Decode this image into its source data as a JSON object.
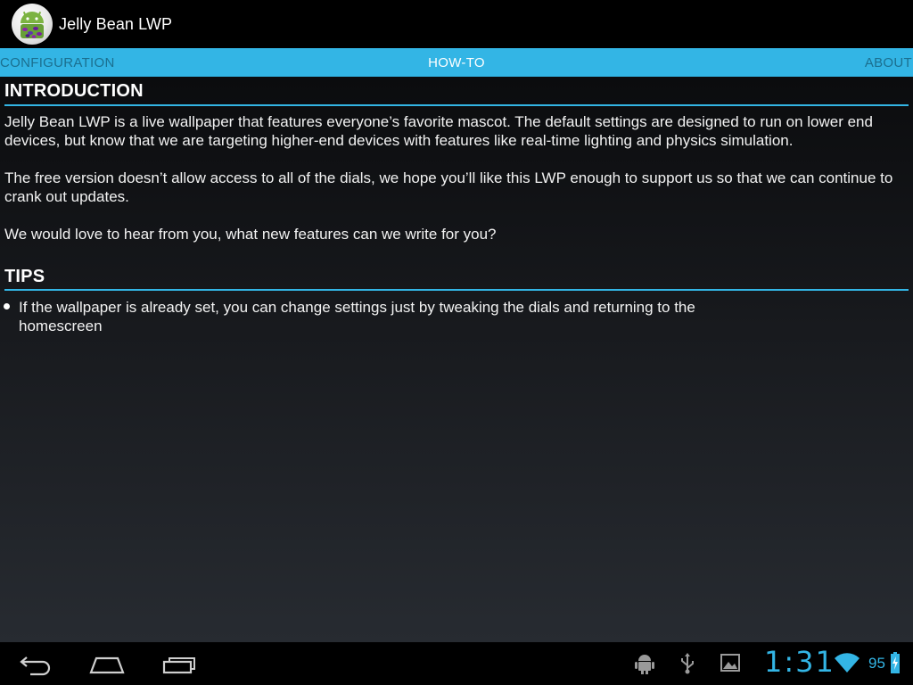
{
  "action_bar": {
    "title": "Jelly Bean LWP",
    "app_icon": "android-mascot-jelly-bean-icon"
  },
  "tabs": [
    {
      "label": "CONFIGURATION",
      "selected": false
    },
    {
      "label": "HOW-TO",
      "selected": true
    },
    {
      "label": "ABOUT",
      "selected": false
    }
  ],
  "sections": {
    "introduction": {
      "title": "INTRODUCTION",
      "paragraphs": [
        "Jelly Bean LWP is a live wallpaper that features everyone’s favorite mascot. The default settings are designed to run on lower end devices, but know that we are targeting higher-end devices with features like real-time lighting and physics simulation.",
        "The free version doesn’t allow access to all of the dials, we hope you’ll like this LWP enough to support us so that we can continue to crank out updates.",
        "We would love to hear from you, what new features can we write for you?"
      ]
    },
    "tips": {
      "title": "TIPS",
      "items": [
        "If the wallpaper is already set, you can change settings just by tweaking the dials and returning to the homescreen"
      ]
    }
  },
  "system_bar": {
    "nav": [
      "back-icon",
      "home-icon",
      "recent-apps-icon"
    ],
    "status_icons": [
      "android-debug-icon",
      "usb-icon",
      "screenshot-icon",
      "wifi-icon",
      "battery-charging-icon"
    ],
    "clock": "1:31",
    "battery_level": "95"
  },
  "colors": {
    "accent": "#33b5e5",
    "tab_inactive_text": "#1b6f8f",
    "background_top": "#0b0c0e",
    "background_bottom": "#272b31"
  }
}
